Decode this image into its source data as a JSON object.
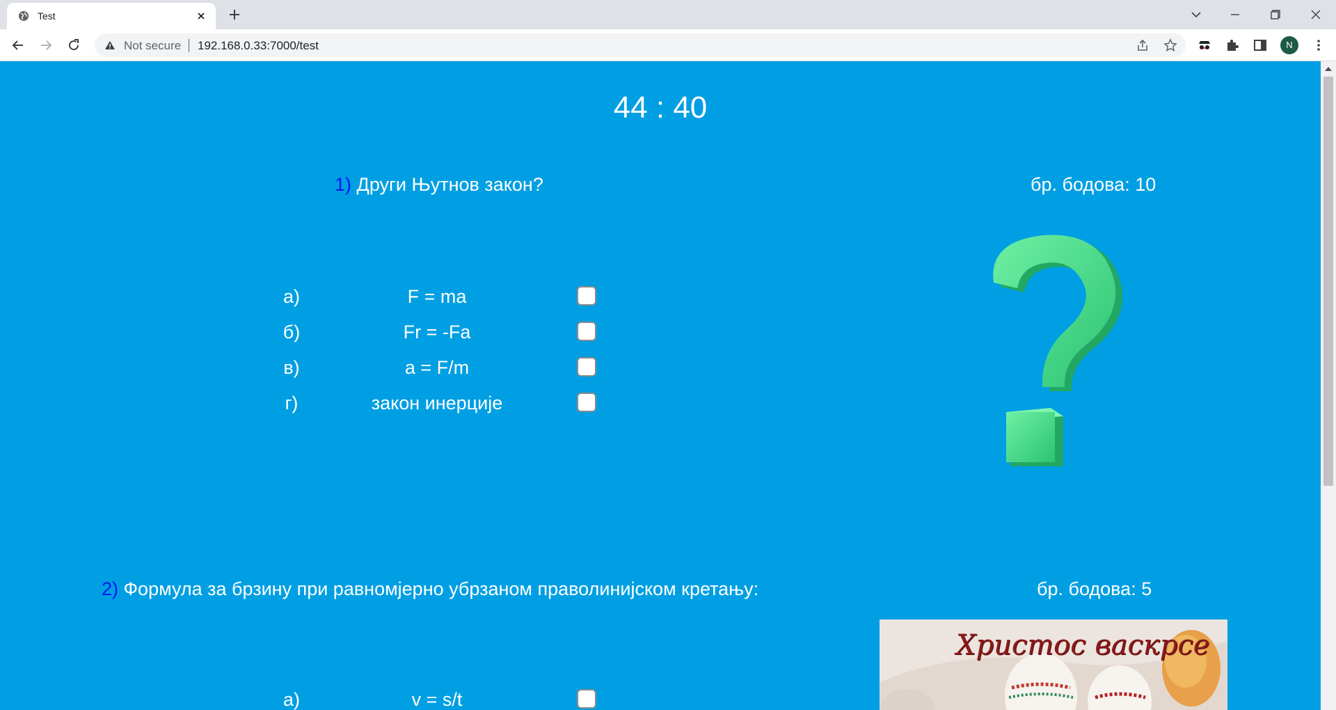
{
  "browser": {
    "tab_title": "Test",
    "omnibox_security": "Not secure",
    "url": "192.168.0.33:7000/test",
    "profile_initial": "N"
  },
  "timer": "44 : 40",
  "questions": [
    {
      "number": "1)",
      "text": "Други Њутнов закон?",
      "points": "бр. бодова: 10",
      "answers": [
        {
          "letter": "а)",
          "text": "F = ma",
          "checked": false
        },
        {
          "letter": "б)",
          "text": "Fr = -Fa",
          "checked": false
        },
        {
          "letter": "в)",
          "text": "a = F/m",
          "checked": false
        },
        {
          "letter": "г)",
          "text": "закон инерције",
          "checked": false
        }
      ],
      "image": "question-mark-icon"
    },
    {
      "number": "2)",
      "text": "Формула за брзину при равномјерно убрзаном праволинијском кретању:",
      "points": "бр. бодова: 5",
      "answers": [
        {
          "letter": "а)",
          "text": "v = s/t",
          "checked": false
        }
      ],
      "image_caption": "Христос васкрсе"
    }
  ],
  "colors": {
    "page_bg": "#009fe3",
    "question_number": "#0018f0",
    "text": "#ffffff",
    "qmark_green": "#4be08a"
  }
}
